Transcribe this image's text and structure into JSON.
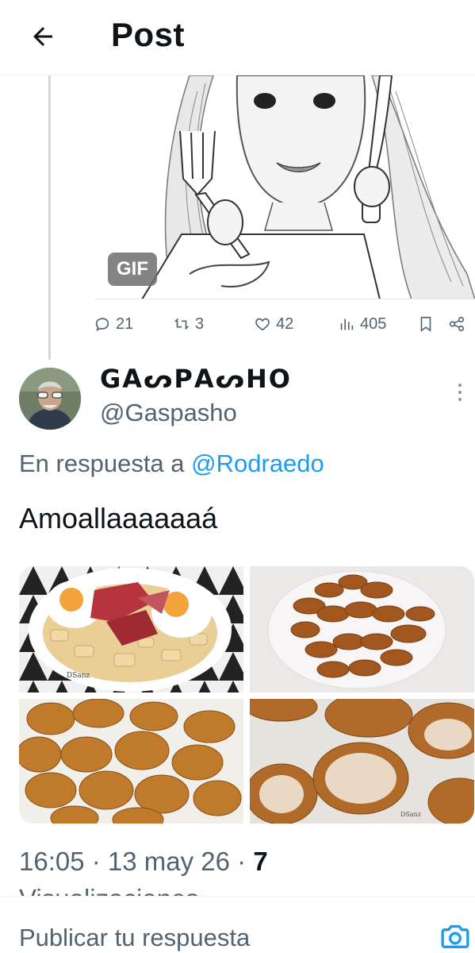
{
  "header": {
    "title": "Post"
  },
  "prev_tweet": {
    "media_badge": "GIF",
    "actions": {
      "replies": "21",
      "reposts": "3",
      "likes": "42",
      "views": "405"
    }
  },
  "reply_tweet": {
    "display_name": "GΑᔕΡΑᔕΗΟ",
    "handle": "@Gaspasho",
    "reply_prefix": "En respuesta a",
    "reply_mention": "@Rodraedo",
    "text": "Amoallaaaaaaá",
    "time": "16:05",
    "date": "13 may 26",
    "views_count": "7",
    "views_label_partial": "Visualizaciones"
  },
  "composer": {
    "placeholder": "Publicar tu respuesta"
  },
  "colors": {
    "accent": "#1d9bf0",
    "muted": "#536471",
    "text": "#0f1419"
  }
}
